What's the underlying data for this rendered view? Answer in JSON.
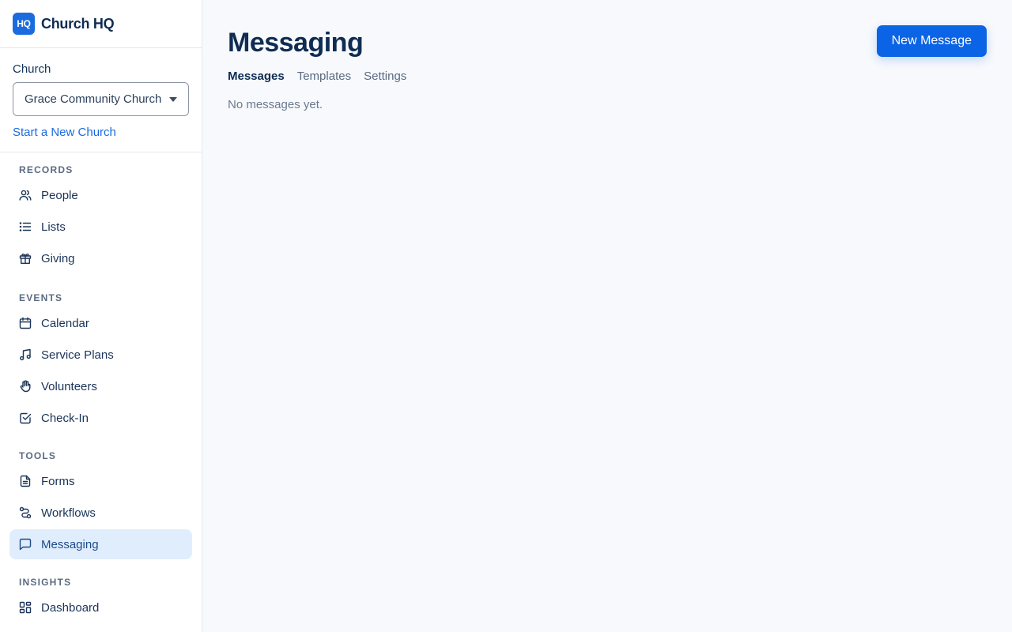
{
  "brand": {
    "logo_text": "HQ",
    "name": "Church HQ"
  },
  "church": {
    "label": "Church",
    "selected": "Grace Community Church",
    "new_church_link": "Start a New Church"
  },
  "nav": {
    "records": {
      "heading": "RECORDS",
      "items": [
        {
          "label": "People",
          "icon": "people-icon"
        },
        {
          "label": "Lists",
          "icon": "list-icon"
        },
        {
          "label": "Giving",
          "icon": "gift-icon"
        }
      ]
    },
    "events": {
      "heading": "EVENTS",
      "items": [
        {
          "label": "Calendar",
          "icon": "calendar-icon"
        },
        {
          "label": "Service Plans",
          "icon": "music-note-icon"
        },
        {
          "label": "Volunteers",
          "icon": "hand-icon"
        },
        {
          "label": "Check-In",
          "icon": "checkbox-icon"
        }
      ]
    },
    "tools": {
      "heading": "TOOLS",
      "items": [
        {
          "label": "Forms",
          "icon": "document-icon"
        },
        {
          "label": "Workflows",
          "icon": "workflow-icon"
        },
        {
          "label": "Messaging",
          "icon": "chat-icon",
          "active": true
        }
      ]
    },
    "insights": {
      "heading": "INSIGHTS",
      "items": [
        {
          "label": "Dashboard",
          "icon": "dashboard-icon"
        }
      ]
    }
  },
  "main": {
    "title": "Messaging",
    "new_button": "New Message",
    "tabs": [
      {
        "label": "Messages",
        "active": true
      },
      {
        "label": "Templates"
      },
      {
        "label": "Settings"
      }
    ],
    "empty_text": "No messages yet."
  },
  "colors": {
    "accent": "#0b63e5",
    "active_nav_bg": "#e0edfd",
    "heading_text": "#0f2c52"
  }
}
